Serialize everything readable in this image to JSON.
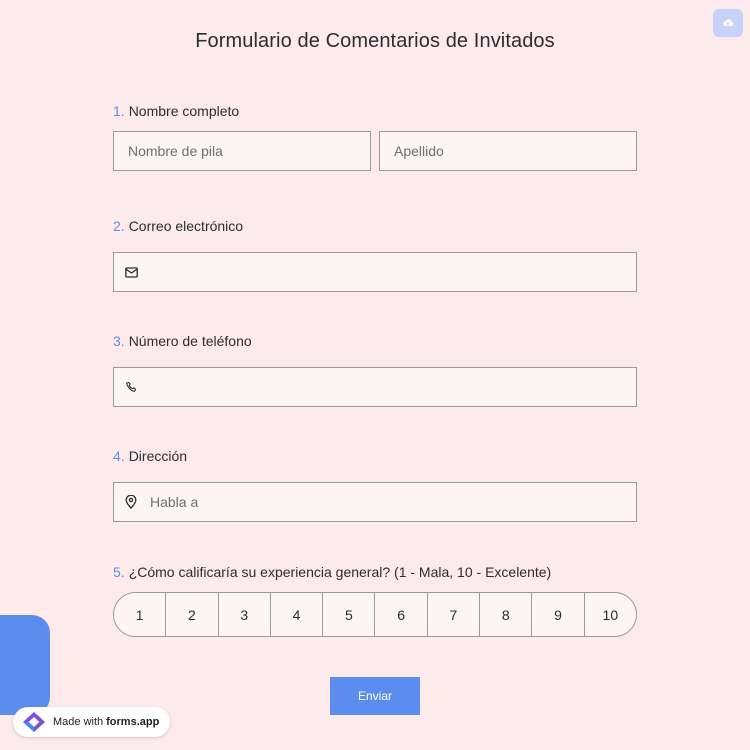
{
  "form": {
    "title": "Formulario de Comentarios de Invitados",
    "upload_icon": "cloud-upload-icon"
  },
  "questions": {
    "q1": {
      "num": "1.",
      "label": "Nombre completo",
      "first_placeholder": "Nombre de pila",
      "last_placeholder": "Apellido"
    },
    "q2": {
      "num": "2.",
      "label": "Correo electrónico",
      "icon": "mail-icon",
      "value": ""
    },
    "q3": {
      "num": "3.",
      "label": "Número de teléfono",
      "icon": "phone-icon",
      "value": ""
    },
    "q4": {
      "num": "4.",
      "label": "Dirección",
      "icon": "location-pin-icon",
      "placeholder": "Habla a"
    },
    "q5": {
      "num": "5.",
      "label": "¿Cómo calificaría su experiencia general? (1 - Mala, 10 - Excelente)",
      "options": [
        "1",
        "2",
        "3",
        "4",
        "5",
        "6",
        "7",
        "8",
        "9",
        "10"
      ]
    }
  },
  "submit_label": "Enviar",
  "badge": {
    "prefix": "Made with",
    "brand": "forms.app"
  },
  "colors": {
    "background": "#fdeaea",
    "accent": "#5b8def",
    "field_bg": "#fdf5f4",
    "border": "#9a9a9a"
  }
}
